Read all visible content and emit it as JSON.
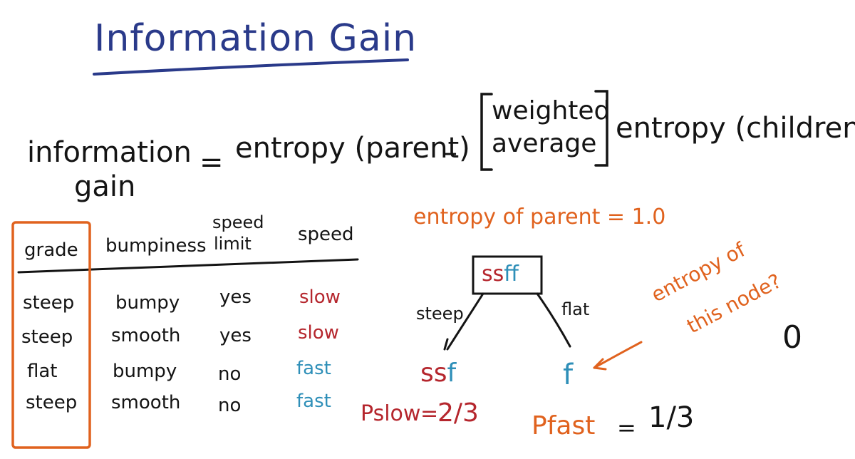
{
  "title": "Information Gain",
  "formula": {
    "lhs_line1": "information",
    "lhs_line2": "gain",
    "equals": "=",
    "term1": "entropy (parent)",
    "minus": "–",
    "bracket_line1": "weighted",
    "bracket_line2": "average",
    "term2": "entropy (children)"
  },
  "table": {
    "headers": [
      "grade",
      "bumpiness",
      "speed limit",
      "speed"
    ],
    "header_speed_limit_line1": "speed",
    "header_speed_limit_line2": "limit",
    "rows": [
      {
        "grade": "steep",
        "bumpiness": "bumpy",
        "limit": "yes",
        "speed": "slow"
      },
      {
        "grade": "steep",
        "bumpiness": "smooth",
        "limit": "yes",
        "speed": "slow"
      },
      {
        "grade": "flat",
        "bumpiness": "bumpy",
        "limit": "no",
        "speed": "fast"
      },
      {
        "grade": "steep",
        "bumpiness": "smooth",
        "limit": "no",
        "speed": "fast"
      }
    ]
  },
  "tree": {
    "parent_entropy_label": "entropy of parent = 1.0",
    "root_node_red": "ss",
    "root_node_blue": "ff",
    "left_edge_label": "steep",
    "right_edge_label": "flat",
    "left_child_red": "ss",
    "left_child_blue": "f",
    "right_child": "f",
    "annotation_line1": "entropy of",
    "annotation_line2": "this node?",
    "answer": "0",
    "p_slow_label": "Pslow",
    "p_slow_eq": "=",
    "p_slow_value": "2/3",
    "p_fast_label": "Pfast",
    "p_fast_eq": "=",
    "p_fast_value": "1/3"
  },
  "colors": {
    "title": "#2a3a8a",
    "orange": "#e0621e",
    "red": "#b5262d",
    "blue": "#2e8fb8",
    "ink": "#141414"
  }
}
